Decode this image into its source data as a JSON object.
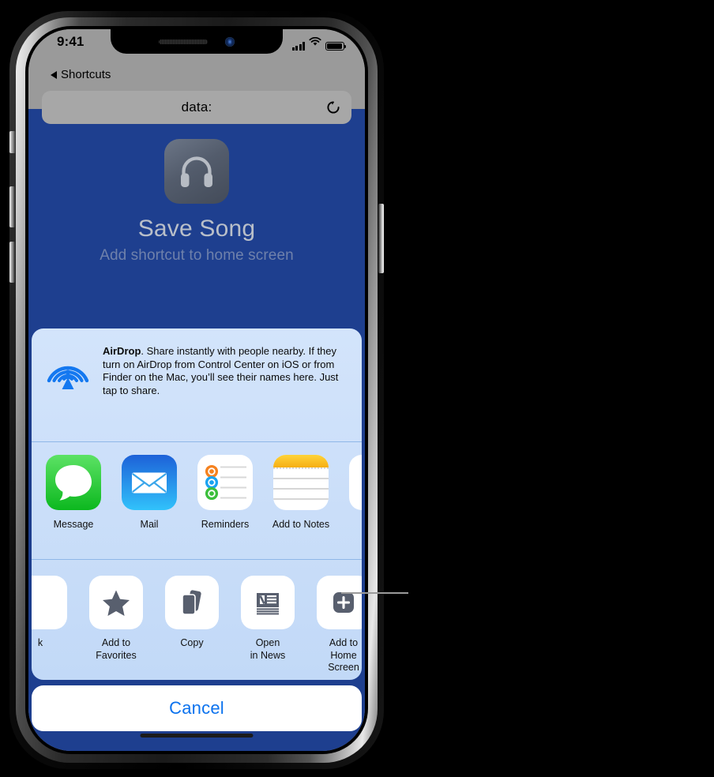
{
  "status_bar": {
    "time": "9:41",
    "signal_icon": "cellular-signal-icon",
    "wifi_icon": "wifi-icon",
    "battery_icon": "battery-full-icon"
  },
  "nav_bar": {
    "back_label": "Shortcuts",
    "back_icon": "back-triangle-icon",
    "url": "data:",
    "reload_icon": "reload-icon"
  },
  "hero": {
    "icon": "headphones-icon",
    "title": "Save Song",
    "subtitle": "Add shortcut to home screen"
  },
  "share_sheet": {
    "airdrop": {
      "icon": "airdrop-icon",
      "name": "AirDrop",
      "body": ". Share instantly with people nearby. If they turn on AirDrop from Control Center on iOS or from Finder on the Mac, you’ll see their names here. Just tap to share."
    },
    "apps": [
      {
        "label": "Message",
        "icon": "messages-app-icon"
      },
      {
        "label": "Mail",
        "icon": "mail-app-icon"
      },
      {
        "label": "Reminders",
        "icon": "reminders-app-icon"
      },
      {
        "label": "Add to Notes",
        "icon": "notes-app-icon"
      },
      {
        "label": "",
        "icon": "partial-app-icon"
      }
    ],
    "actions": [
      {
        "label": "k",
        "icon": "partial-bookmark-icon"
      },
      {
        "label": "Add to\nFavorites",
        "icon": "star-icon"
      },
      {
        "label": "Copy",
        "icon": "copy-icon"
      },
      {
        "label": "Open\nin News",
        "icon": "news-icon"
      },
      {
        "label": "Add to\nHome Screen",
        "icon": "plus-square-icon"
      }
    ],
    "cancel_label": "Cancel"
  },
  "colors": {
    "page_blue": "#1e3f8f",
    "sheet_blue": "#c9dffa",
    "accent_blue": "#0b72ee",
    "status_bar_gray": "#9a9a9a"
  }
}
